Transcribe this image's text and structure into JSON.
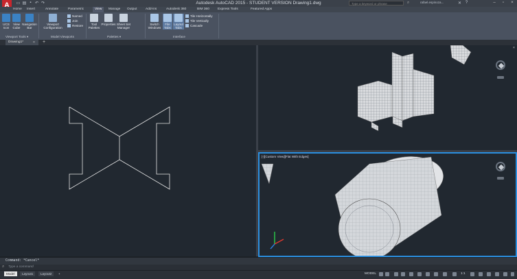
{
  "titlebar": {
    "app_title": "Autodesk AutoCAD 2015 - STUDENT VERSION    Drawing1.dwg",
    "logo_letter": "A",
    "search_placeholder": "Type a keyword or phrase",
    "user_name": "rafael.espinoza..."
  },
  "ribbon_tabs": [
    "Home",
    "Insert",
    "Annotate",
    "Parametric",
    "View",
    "Manage",
    "Output",
    "Add-ins",
    "Autodesk 360",
    "BIM 360",
    "Express Tools",
    "Featured Apps"
  ],
  "active_tab": "View",
  "ribbon": {
    "viewport_tools": {
      "ucs_icon": "UCS\nIcon",
      "view_cube": "View\nCube",
      "navigation_bar": "Navigation\nBar",
      "label": "Viewport Tools ▾"
    },
    "model_viewports": {
      "viewport_configuration": "Viewport\nConfiguration",
      "named": "Named",
      "join": "Join",
      "restore": "Restore",
      "label": "Model Viewports"
    },
    "palettes": {
      "tool_palettes": "Tool\nPalettes",
      "properties": "Properties",
      "sheet_set_manager": "Sheet Set\nManager",
      "label": "Palettes ▾"
    },
    "interface": {
      "switch_windows": "Switch\nWindows",
      "file_tabs": "File\nTabs",
      "layout_tabs": "Layout\nTabs",
      "tile_horizontally": "Tile Horizontally",
      "tile_vertically": "Tile Vertically",
      "cascade": "Cascade",
      "label": "Interface"
    }
  },
  "file_tabs": {
    "active_file": "Drawing1*",
    "close_glyph": "×",
    "add_glyph": "+"
  },
  "viewports": {
    "bottom_right_label": "[-][Custom View][Flat With Edges]",
    "close_glyph": "×"
  },
  "command": {
    "history_line": "Command: *Cancel*",
    "prompt_placeholder": "Type a command"
  },
  "status_bar": {
    "layout_tabs": [
      "Model",
      "Layout1",
      "Layout2"
    ],
    "active_layout": "Model",
    "add_glyph": "+",
    "model_label": "MODEL",
    "scale_label": "1:1"
  },
  "colors": {
    "accent_blue": "#2b8fe0",
    "logo_red": "#c8262d",
    "viewport_bg": "#212830"
  }
}
